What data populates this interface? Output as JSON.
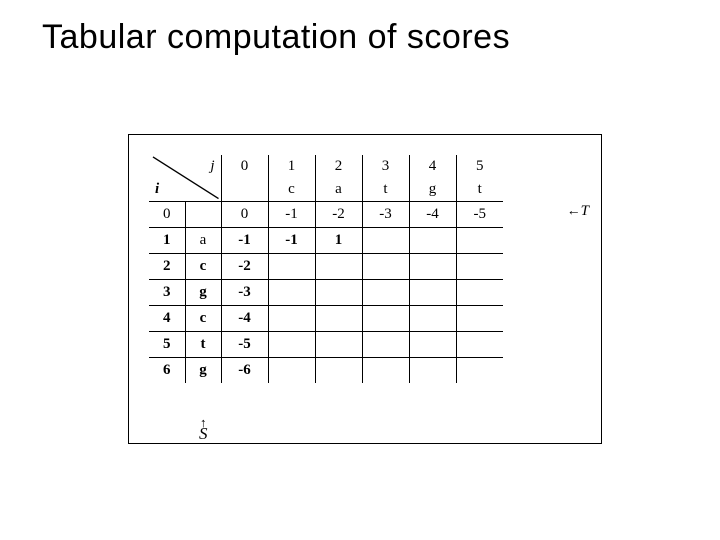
{
  "title": "Tabular computation of scores",
  "corner": {
    "j": "j",
    "i": "i"
  },
  "j_idx": [
    "0",
    "1",
    "2",
    "3",
    "4",
    "5"
  ],
  "T_seq": [
    "c",
    "a",
    "t",
    "g",
    "t"
  ],
  "i_idx": [
    "0",
    "1",
    "2",
    "3",
    "4",
    "5",
    "6"
  ],
  "S_seq": [
    "",
    "a",
    "c",
    "g",
    "c",
    "t",
    "g"
  ],
  "rows": [
    [
      "0",
      "-1",
      "-2",
      "-3",
      "-4",
      "-5"
    ],
    [
      "-1",
      "-1",
      "1",
      "",
      "",
      ""
    ],
    [
      "-2",
      "",
      "",
      "",
      "",
      ""
    ],
    [
      "-3",
      "",
      "",
      "",
      "",
      ""
    ],
    [
      "-4",
      "",
      "",
      "",
      "",
      ""
    ],
    [
      "-5",
      "",
      "",
      "",
      "",
      ""
    ],
    [
      "-6",
      "",
      "",
      "",
      "",
      ""
    ]
  ],
  "T_label": "T",
  "S_label": "S",
  "arrow_left": "←",
  "arrow_up": "↑"
}
